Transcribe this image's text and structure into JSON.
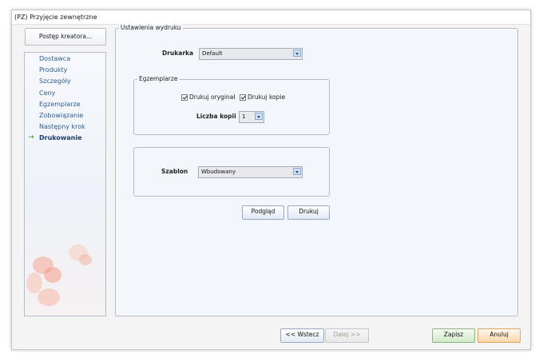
{
  "window": {
    "title": "(PZ) Przyjęcie zewnętrzne"
  },
  "wizard": {
    "progress_button": "Postęp kreatora...",
    "active_marker": "→",
    "steps": [
      {
        "label": "Dostawca",
        "active": false
      },
      {
        "label": "Produkty",
        "active": false
      },
      {
        "label": "Szczegóły",
        "active": false
      },
      {
        "label": "Ceny",
        "active": false
      },
      {
        "label": "Egzemplarze",
        "active": false
      },
      {
        "label": "Zobowiązanie",
        "active": false
      },
      {
        "label": "Następny krok",
        "active": false
      },
      {
        "label": "Drukowanie",
        "active": true
      }
    ]
  },
  "print_settings": {
    "legend": "Ustawienia wydruku",
    "printer_label": "Drukarka",
    "printer_value": "Default",
    "copies_group": {
      "legend": "Egzemplarze",
      "print_original_label": "Drukuj oryginał",
      "print_original_checked": true,
      "print_copy_label": "Drukuj kopie",
      "print_copy_checked": true,
      "copies_count_label": "Liczba kopii",
      "copies_count_value": "1"
    },
    "template_label": "Szablon",
    "template_value": "Wbudowany",
    "preview_button": "Podgląd",
    "print_button": "Drukuj"
  },
  "footer": {
    "back_button": "<< Wstecz",
    "next_button": "Dalej >>",
    "save_button": "Zapisz",
    "cancel_button": "Anuluj"
  },
  "colors": {
    "active_arrow": "#2c9a2c",
    "save_accent": "#cfe9c6",
    "cancel_accent": "#fbd6a9",
    "step_text": "#2f5d8f"
  }
}
